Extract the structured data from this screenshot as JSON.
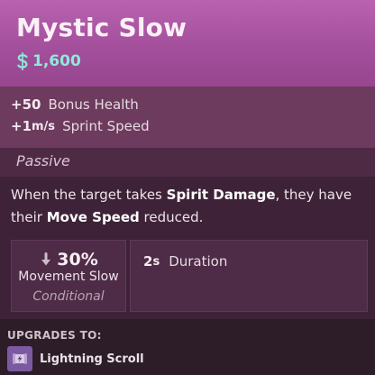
{
  "item": {
    "name": "Mystic Slow",
    "cost": "1,600",
    "colors": {
      "header": "#a44f9c",
      "stats_bg": "#6d3b5e",
      "passive_bar": "#4e2a45",
      "body_bg": "#3e2338",
      "cost_color": "#8fe9d8"
    }
  },
  "stats": [
    {
      "value": "+50",
      "unit": "",
      "label": "Bonus Health"
    },
    {
      "value": "+1",
      "unit": "m/s",
      "label": "Sprint Speed"
    }
  ],
  "passive": {
    "label": "Passive",
    "desc_part1": "When the target takes ",
    "desc_bold1": "Spirit Damage",
    "desc_part2": ", they have their ",
    "desc_bold2": "Move Speed",
    "desc_part3": " reduced."
  },
  "properties": {
    "slow": {
      "value": "30%",
      "label": "Movement Slow",
      "condition": "Conditional",
      "icon": "slow-arrow-icon"
    },
    "duration": {
      "value": "2",
      "unit": "s",
      "label": "Duration"
    }
  },
  "upgrades": {
    "title": "UPGRADES TO:",
    "items": [
      {
        "name": "Lightning Scroll",
        "icon": "lightning-scroll-icon"
      }
    ]
  }
}
